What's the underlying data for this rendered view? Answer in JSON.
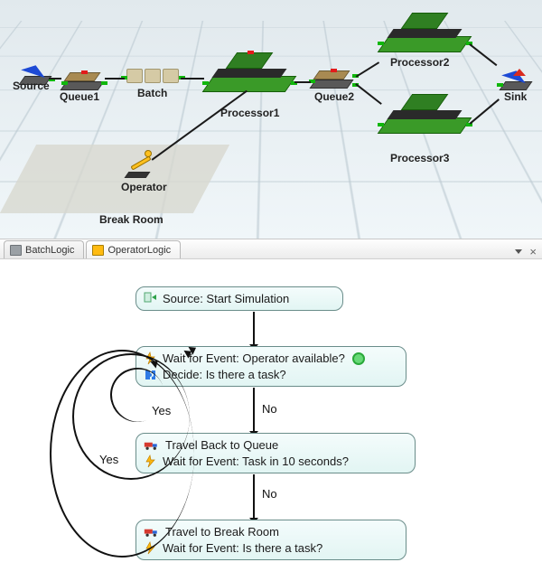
{
  "model": {
    "labels": {
      "source": "Source",
      "queue1": "Queue1",
      "batch": "Batch",
      "processor1": "Processor1",
      "queue2": "Queue2",
      "processor2": "Processor2",
      "processor3": "Processor3",
      "sink": "Sink",
      "operator": "Operator",
      "breakroom": "Break Room"
    }
  },
  "tabs": {
    "items": [
      {
        "label": "BatchLogic",
        "icon": "gray",
        "active": false
      },
      {
        "label": "OperatorLogic",
        "icon": "truck",
        "active": true
      }
    ],
    "close": "×"
  },
  "flow": {
    "n1": {
      "lines": [
        {
          "icon": "src",
          "text": "Source: Start Simulation"
        }
      ]
    },
    "n2": {
      "lines": [
        {
          "icon": "bolt",
          "text": "Wait for Event: Operator available?",
          "greendot": true
        },
        {
          "icon": "puzzle",
          "text": "Decide: Is there a task?"
        }
      ]
    },
    "n3": {
      "lines": [
        {
          "icon": "truck",
          "text": "Travel Back to Queue"
        },
        {
          "icon": "bolt",
          "text": "Wait for Event: Task in 10 seconds?"
        }
      ]
    },
    "n4": {
      "lines": [
        {
          "icon": "truck",
          "text": "Travel to Break Room"
        },
        {
          "icon": "bolt",
          "text": "Wait for Event: Is there a task?"
        }
      ]
    },
    "labels": {
      "yes1": "Yes",
      "no1": "No",
      "yes2": "Yes",
      "no2": "No"
    }
  }
}
